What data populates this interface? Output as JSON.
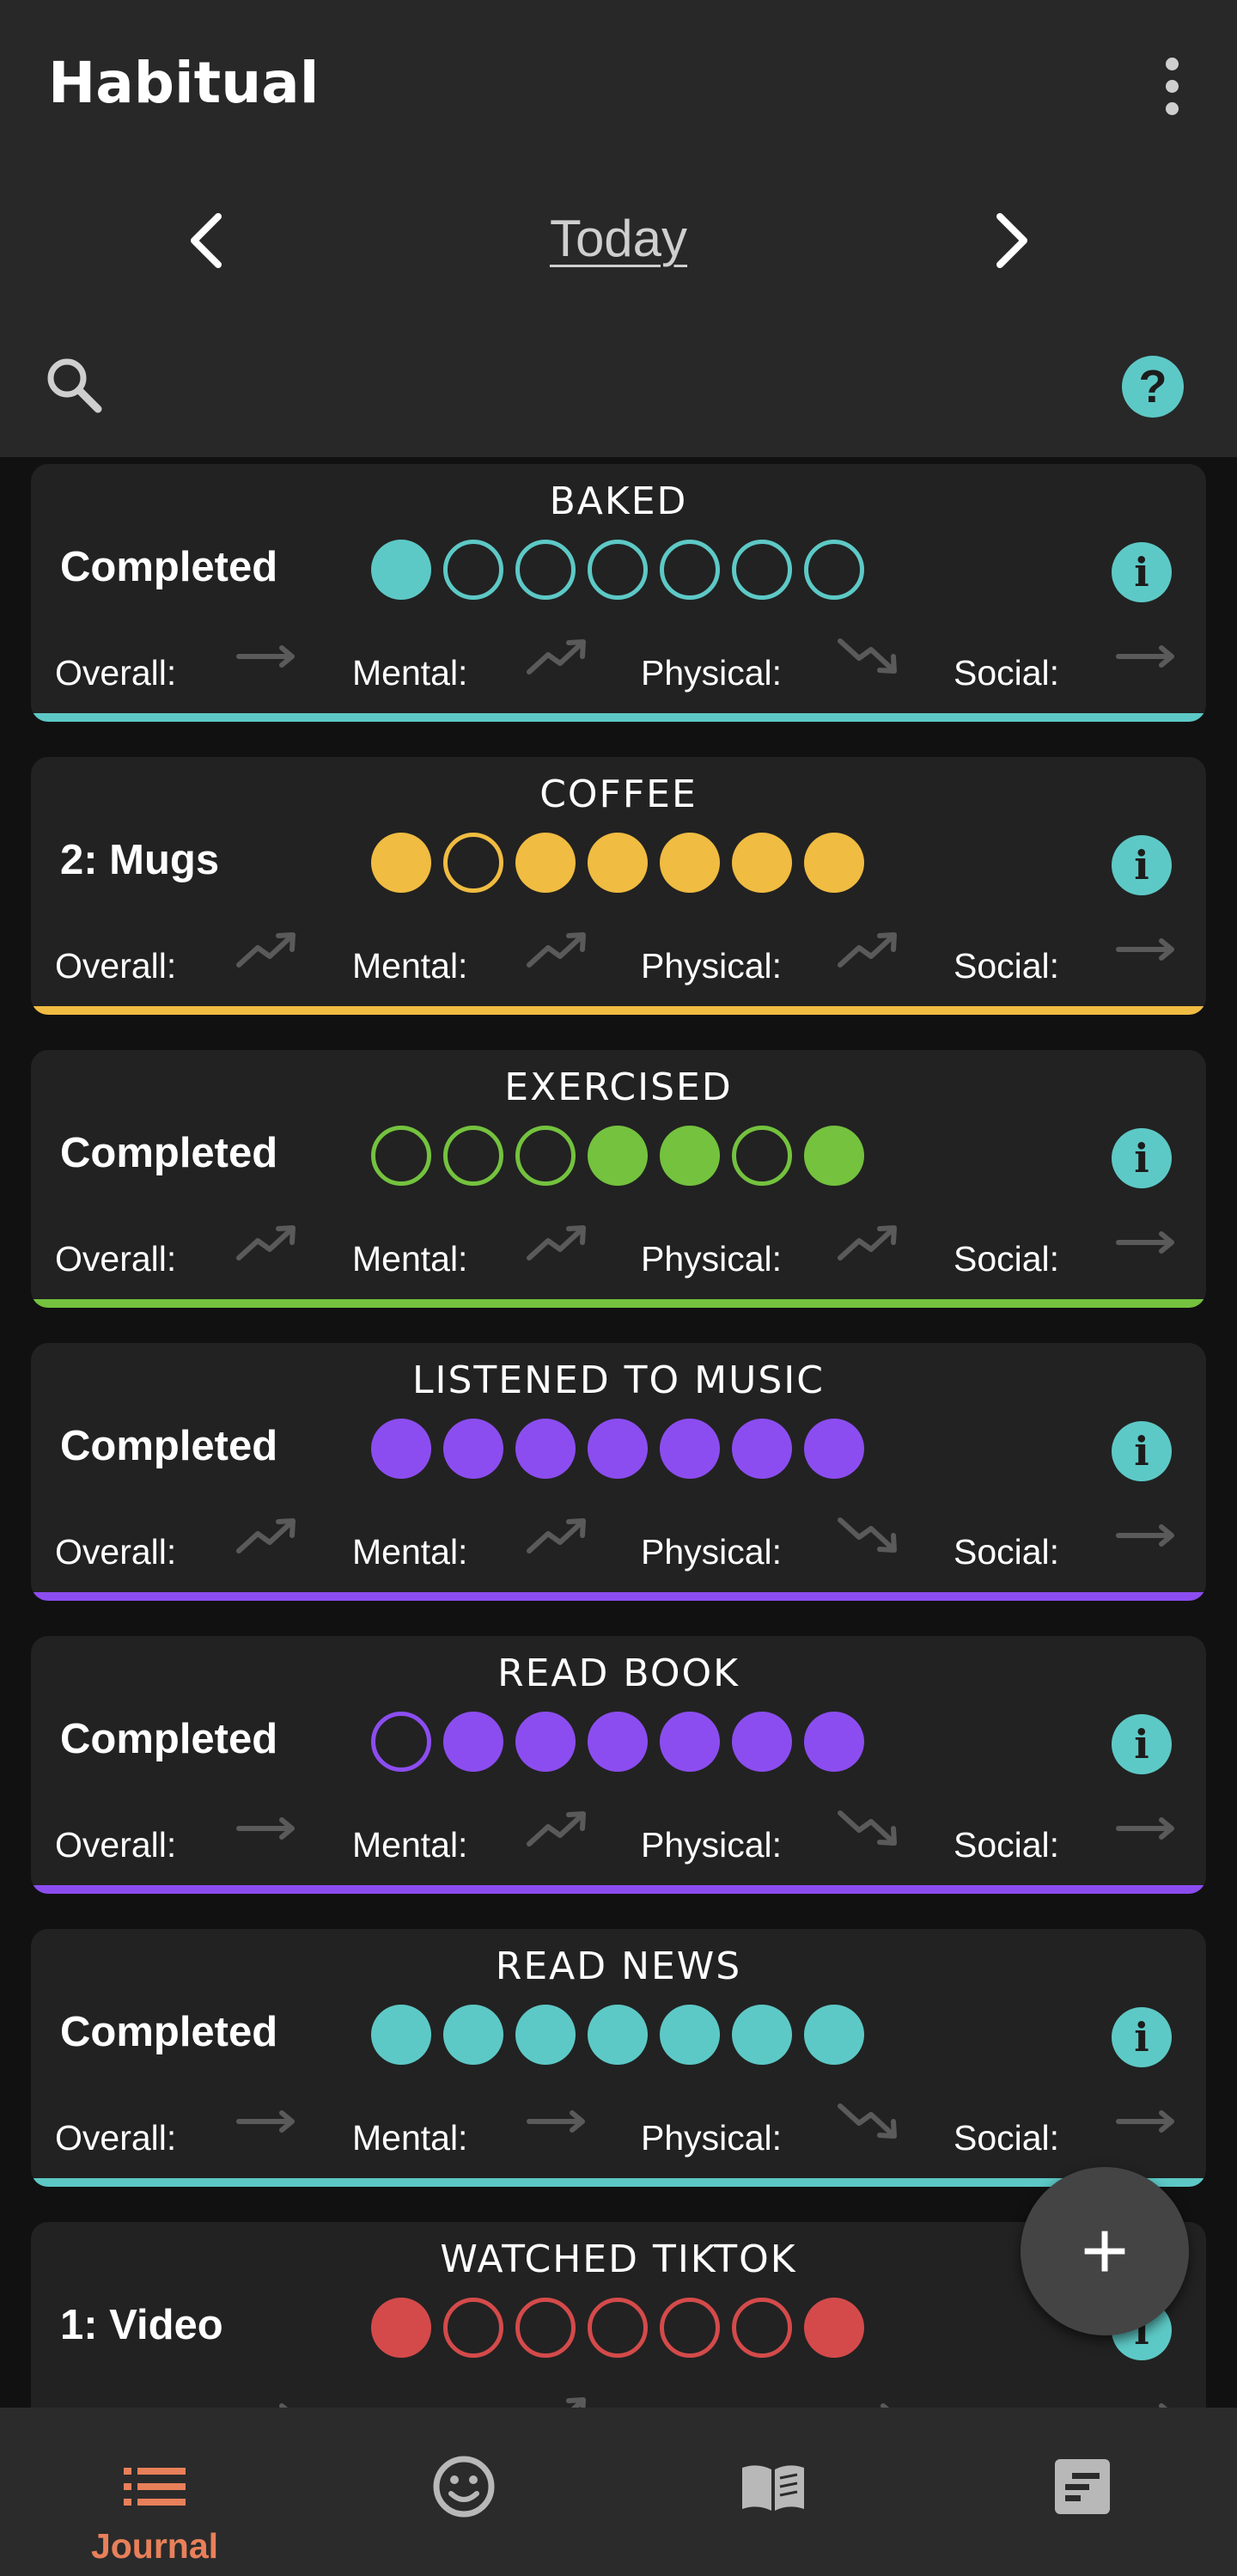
{
  "app": {
    "title": "Habitual"
  },
  "date_nav": {
    "label": "Today"
  },
  "colors": {
    "teal": "#5dc9c6",
    "yellow": "#f0bc41",
    "green": "#74c23e",
    "purple": "#8c4df0",
    "red": "#d44a4a",
    "accent": "#e8805a"
  },
  "stat_labels": {
    "overall": "Overall:",
    "mental": "Mental:",
    "physical": "Physical:",
    "social": "Social:"
  },
  "habits": [
    {
      "name": "BAKED",
      "status": "Completed",
      "color": "#5dc9c6",
      "days": [
        1,
        0,
        0,
        0,
        0,
        0,
        0
      ],
      "trends": {
        "overall": "flat",
        "mental": "up",
        "physical": "down",
        "social": "flat"
      }
    },
    {
      "name": "COFFEE",
      "status": "2: Mugs",
      "color": "#f0bc41",
      "days": [
        1,
        0,
        1,
        1,
        1,
        1,
        1
      ],
      "trends": {
        "overall": "up",
        "mental": "up",
        "physical": "up",
        "social": "flat"
      }
    },
    {
      "name": "EXERCISED",
      "status": "Completed",
      "color": "#74c23e",
      "days": [
        0,
        0,
        0,
        1,
        1,
        0,
        1
      ],
      "trends": {
        "overall": "up",
        "mental": "up",
        "physical": "up",
        "social": "flat"
      }
    },
    {
      "name": "LISTENED TO MUSIC",
      "status": "Completed",
      "color": "#8c4df0",
      "days": [
        1,
        1,
        1,
        1,
        1,
        1,
        1
      ],
      "trends": {
        "overall": "up",
        "mental": "up",
        "physical": "down",
        "social": "flat"
      }
    },
    {
      "name": "READ BOOK",
      "status": "Completed",
      "color": "#8c4df0",
      "days": [
        0,
        1,
        1,
        1,
        1,
        1,
        1
      ],
      "trends": {
        "overall": "flat",
        "mental": "up",
        "physical": "down",
        "social": "flat"
      }
    },
    {
      "name": "READ NEWS",
      "status": "Completed",
      "color": "#5dc9c6",
      "days": [
        1,
        1,
        1,
        1,
        1,
        1,
        1
      ],
      "trends": {
        "overall": "flat",
        "mental": "flat",
        "physical": "down",
        "social": "flat"
      }
    },
    {
      "name": "WATCHED TIKTOK",
      "status": "1: Video",
      "color": "#d44a4a",
      "days": [
        1,
        0,
        0,
        0,
        0,
        0,
        1
      ],
      "trends": {
        "overall": "flat",
        "mental": "up",
        "physical": "flat",
        "social": "flat"
      }
    }
  ],
  "bottom_nav": [
    {
      "label": "Journal",
      "icon": "list-icon",
      "active": true
    },
    {
      "label": "",
      "icon": "smiley-icon",
      "active": false
    },
    {
      "label": "",
      "icon": "book-icon",
      "active": false
    },
    {
      "label": "",
      "icon": "notes-icon",
      "active": false
    }
  ]
}
